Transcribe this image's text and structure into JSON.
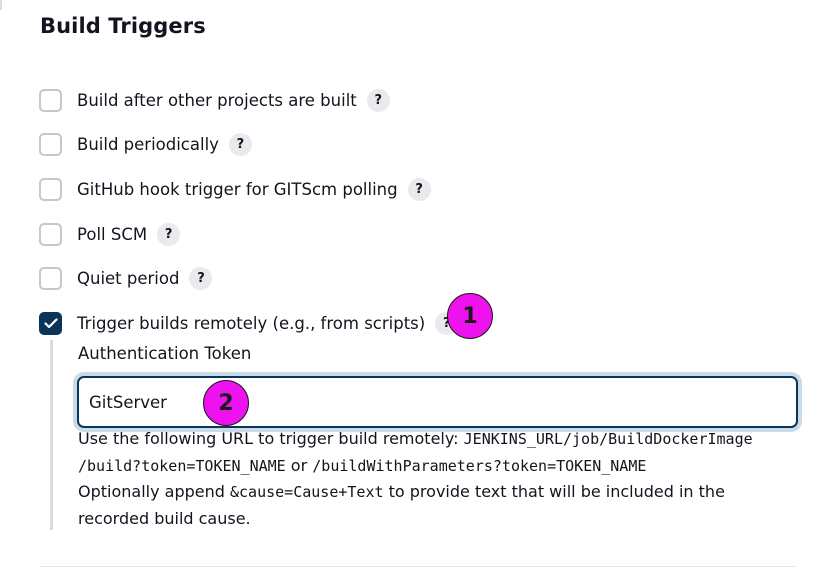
{
  "section": {
    "title": "Build Triggers"
  },
  "triggers": [
    {
      "label": "Build after other projects are built",
      "checked": false
    },
    {
      "label": "Build periodically",
      "checked": false
    },
    {
      "label": "GitHub hook trigger for GITScm polling",
      "checked": false
    },
    {
      "label": "Poll SCM",
      "checked": false
    },
    {
      "label": "Quiet period",
      "checked": false
    },
    {
      "label": "Trigger builds remotely (e.g., from scripts)",
      "checked": true
    }
  ],
  "help_glyph": "?",
  "callouts": {
    "one": "1",
    "two": "2"
  },
  "remote": {
    "token_label": "Authentication Token",
    "token_value": "GitServer",
    "help_line1_prefix": "Use the following URL to trigger build remotely: ",
    "help_url1": "JENKINS_URL/job/BuildDockerImage",
    "help_url2": "/build?token=TOKEN_NAME",
    "help_or": " or ",
    "help_url3": "/buildWithParameters?token=TOKEN_NAME",
    "help_line3_prefix": "Optionally append ",
    "help_cause": "&cause=Cause+Text",
    "help_line3_suffix": " to provide text that will be included in the recorded build cause."
  },
  "colors": {
    "checked_bg": "#0b3558",
    "callout": "#ee12ee",
    "focus_ring": "#c9dbe7"
  },
  "icons": {
    "checkmark": "check-icon",
    "help": "help-icon"
  }
}
